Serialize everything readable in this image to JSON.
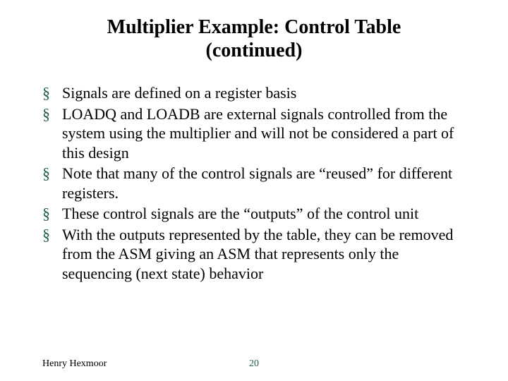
{
  "title_line1": "Multiplier Example: Control Table",
  "title_line2": "(continued)",
  "bullets": [
    "Signals are defined on a register basis",
    "LOADQ and LOADB are external signals controlled from the system using the multiplier and will not be considered a part of this design",
    "Note that many of the control signals are “reused” for different registers.",
    "These control signals are the “outputs” of the control unit",
    "With the outputs represented by the table, they can be removed from the ASM giving an ASM that represents only the sequencing (next state) behavior"
  ],
  "footer": {
    "author": "Henry Hexmoor",
    "page": "20"
  },
  "colors": {
    "accent": "#1f5e4b"
  }
}
